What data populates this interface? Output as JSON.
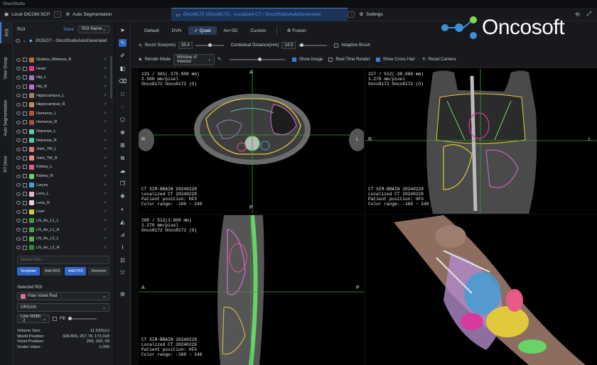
{
  "app": {
    "title": "OncoStudio"
  },
  "tabs": [
    {
      "label": "Local DICOM SCP"
    },
    {
      "label": "Auto Segmentation"
    },
    {
      "label": "Onco8172 (Onco8172) - Localized CT / OncoStudioAutoGenerated"
    },
    {
      "label": "Settings"
    }
  ],
  "vtabs": [
    "ROI",
    "View Group",
    "Auto Segmentation",
    "RT Dose"
  ],
  "roi_panel": {
    "header": "ROI",
    "save": "Save",
    "sort": "ROI Name",
    "tree_label": "2025/2/7 - OncoStudioAutoGenerated",
    "items": [
      {
        "name": "Gluteus_Minimus_R",
        "color": "#c46a3a"
      },
      {
        "name": "Heart",
        "color": "#d63a9c"
      },
      {
        "name": "Hip_L",
        "color": "#9b7ac9"
      },
      {
        "name": "Hip_R",
        "color": "#c06bd6"
      },
      {
        "name": "Hippocampus_L",
        "color": "#b07c56"
      },
      {
        "name": "Hippocampus_R",
        "color": "#c98a5e"
      },
      {
        "name": "Humerus_L",
        "color": "#b5523a"
      },
      {
        "name": "Humerus_R",
        "color": "#a8503a"
      },
      {
        "name": "Iliopsoas_L",
        "color": "#5fc4a5"
      },
      {
        "name": "Iliopsoas_R",
        "color": "#4ec5a0"
      },
      {
        "name": "Joint_TM_L",
        "color": "#e37c7c"
      },
      {
        "name": "Joint_TM_R",
        "color": "#e88a8a"
      },
      {
        "name": "Kidney_L",
        "color": "#e85a8a"
      },
      {
        "name": "Kidney_R",
        "color": "#66d466"
      },
      {
        "name": "Larynx",
        "color": "#3fa0d6"
      },
      {
        "name": "Lens_L",
        "color": "#e5b8c4"
      },
      {
        "name": "Lens_R",
        "color": "#f2d0d8"
      },
      {
        "name": "Liver",
        "color": "#d7ce2f"
      },
      {
        "name": "LN_Ax_L1_L",
        "color": "#3d9a3d"
      },
      {
        "name": "LN_Ax_L1_R",
        "color": "#4aa54a"
      },
      {
        "name": "LN_Ax_L2_L",
        "color": "#57b257"
      },
      {
        "name": "LN_Ax_L2_R",
        "color": "#2f8a2f"
      }
    ],
    "search_placeholder": "Search ROI...",
    "buttons": [
      "Template",
      "Add ROI",
      "Add POI",
      "Remove"
    ],
    "selected_label": "Selected ROI",
    "selected_name": "Pale Violet Red",
    "selected_color": "#db7093",
    "type": "ORGAN",
    "line_width": "Line Width : 2",
    "fill": "Fill",
    "stats": [
      {
        "k": "Volume Size:",
        "v": "11.532(cc)"
      },
      {
        "k": "World Position:",
        "v": "328.809, 257.78, 173.318"
      },
      {
        "k": "Voxel Position:",
        "v": "259, 203, 69"
      },
      {
        "k": "Scalar Value:",
        "v": "-1,000"
      }
    ]
  },
  "toolbar": {
    "modes": [
      "Default",
      "DVH",
      "Quad",
      "Ax+3D",
      "Custom"
    ],
    "fusion": "Fusion",
    "brush_size_label": "Brush Size(mm)",
    "brush_size": "35.4",
    "context_label": "Contextual Distance(mm)",
    "context": "14.3",
    "adaptive": "Adaptive Brush",
    "render_mode_label": "Render Mode",
    "render_mode": "Window of Interest",
    "show_image": "Show Image",
    "realtime": "Real Time Render",
    "crosshair": "Show Cross Hair",
    "reset": "Reset Camera"
  },
  "viewports": {
    "axial": {
      "info": [
        "131 / 361(-375.000 mm)",
        "2.500 mm/pixel",
        "Onco8172 Onco8172 (O)"
      ],
      "bottom": [
        "CT SIM-BRAIN 20240228",
        "Localized CT 20240228",
        "Patient position: HFS",
        "Color range: -160 ~ 240"
      ],
      "top": "A",
      "bottom_o": "P",
      "left": "R",
      "right": "L"
    },
    "coronal": {
      "info": [
        "227 / 512(-38.086 mm)",
        "1.270 mm/pixel",
        "Onco8172 Onco8172 (O)"
      ],
      "bottom": [
        "CT SIM-BRAIN 20240228",
        "Localized CT 20240228",
        "Patient position: HFS",
        "Color range: -160 ~ 240"
      ],
      "left": "R",
      "right": "L"
    },
    "sagittal": {
      "info": [
        "200 / 512(3.809 mm)",
        "1.270 mm/pixel",
        "Onco8172 Onco8172 (O)"
      ],
      "bottom": [
        "CT SIM-BRAIN 20240228",
        "Localized CT 20240228",
        "Patient position: HFS",
        "Color range: -160 ~ 240"
      ],
      "left": "A",
      "right": "P"
    }
  },
  "logo": {
    "text": "Oncosoft"
  },
  "colors": {
    "accent": "#2f66c9",
    "logo_green": "#7ed957",
    "logo_blue": "#3a8fd6"
  }
}
